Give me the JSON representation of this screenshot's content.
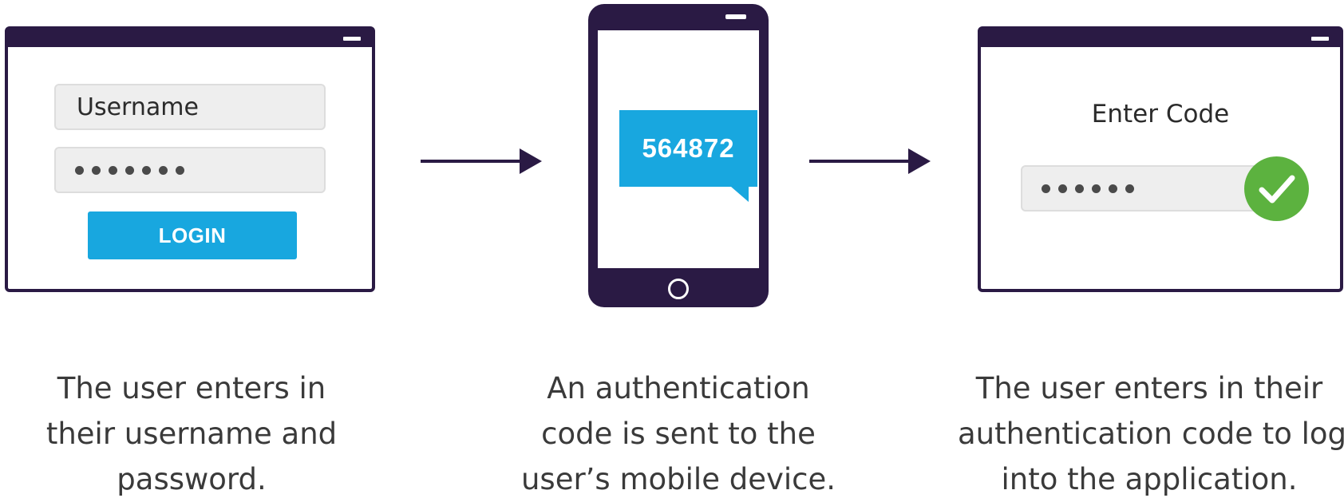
{
  "login_window": {
    "username_placeholder": "Username",
    "password_dot_count": 7,
    "login_label": "LOGIN"
  },
  "phone": {
    "sms_code": "564872"
  },
  "verify_window": {
    "enter_code_label": "Enter Code",
    "code_dot_count": 6,
    "status": "verified"
  },
  "captions": [
    [
      "The user enters in",
      "their username and",
      "password."
    ],
    [
      "An authentication",
      "code is sent to the",
      "user’s mobile device."
    ],
    [
      "The user enters in their",
      "authentication code to log",
      "into the application."
    ]
  ],
  "colors": {
    "frame": "#2a1a44",
    "accent": "#18a7df",
    "success": "#5cb23f",
    "field_bg": "#eeeeee"
  },
  "icons": {
    "arrows": "arrow-right-icon",
    "check": "checkmark-icon",
    "minimize": "minimize-icon"
  }
}
